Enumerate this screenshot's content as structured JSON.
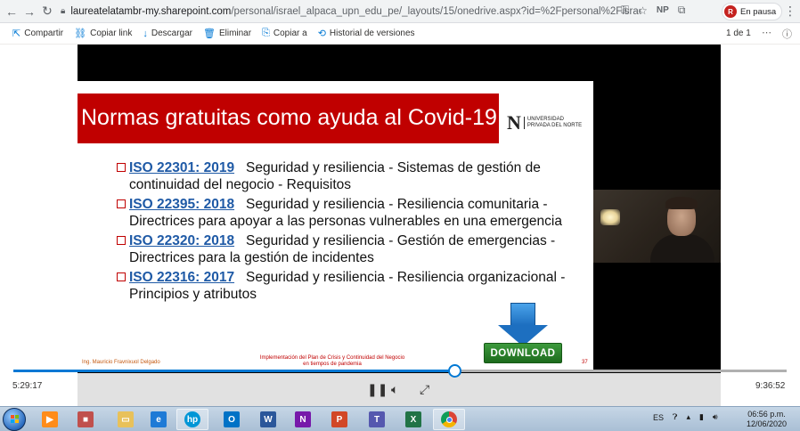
{
  "browser": {
    "url_domain": "laureatelatambr-my.sharepoint.com",
    "url_path": "/personal/israel_alpaca_upn_edu_pe/_layouts/15/onedrive.aspx?id=%2Fpersonal%2Fisrael_alpaca_upn_edu_pe%2F...",
    "profile_initial": "R",
    "profile_status": "En pausa",
    "extension_label": "NP"
  },
  "toolbar": {
    "share": "Compartir",
    "copy_link": "Copiar link",
    "download": "Descargar",
    "delete": "Eliminar",
    "copy_to": "Copiar a",
    "version_history": "Historial de versiones",
    "page_count": "1 de 1"
  },
  "slide": {
    "title": "Normas gratuitas como ayuda al Covid-19",
    "logo_letter": "N",
    "logo_line1": "UNIVERSIDAD",
    "logo_line2": "PRIVADA DEL NORTE",
    "items": [
      {
        "code": "ISO 22301: 2019",
        "desc1": "Seguridad y resiliencia - Sistemas de gestión de",
        "desc2": "continuidad del negocio - Requisitos"
      },
      {
        "code": "ISO 22395: 2018",
        "desc1": "Seguridad y resiliencia - Resiliencia comunitaria -",
        "desc2": "Directrices para apoyar a las personas vulnerables en una emergencia"
      },
      {
        "code": "ISO 22320: 2018",
        "desc1": "Seguridad y resiliencia - Gestión de emergencias -",
        "desc2": "Directrices para la gestión de incidentes"
      },
      {
        "code": "ISO 22316: 2017",
        "desc1": "Seguridad y resiliencia - Resiliencia organizacional -",
        "desc2": "Principios y atributos"
      }
    ],
    "download_label": "DOWNLOAD",
    "footer_left": "Ing. Mauricio Fravnixuol Delgado",
    "footer_center_line1": "Implementación del Plan de Crisis y Continuidad del Negocio",
    "footer_center_line2": "en tiempos de pandemia",
    "page_number": "37"
  },
  "player": {
    "current_time": "5:29:17",
    "total_time": "9:36:52",
    "progress": 0.57
  },
  "taskbar": {
    "language": "ES",
    "time": "06:56 p.m.",
    "date": "12/06/2020"
  },
  "colors": {
    "slide_red": "#c00000",
    "link_blue": "#1f5aa6",
    "progress_blue": "#0078d4"
  }
}
